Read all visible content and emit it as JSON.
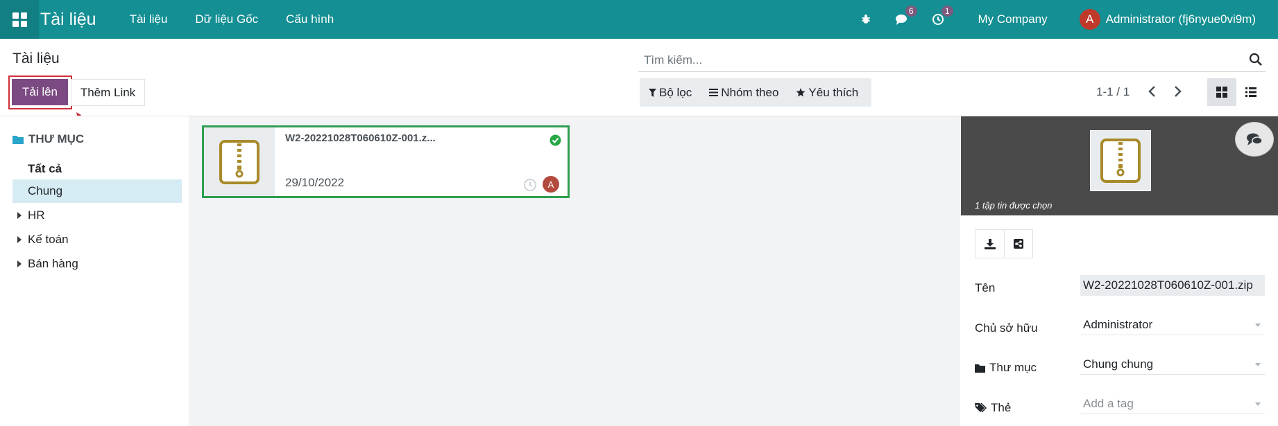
{
  "navbar": {
    "app_title": "Tài liệu",
    "menu": [
      "Tài liệu",
      "Dữ liệu Gốc",
      "Cấu hình"
    ],
    "messages_count": "6",
    "activities_count": "1",
    "company": "My Company",
    "user_initial": "A",
    "user_name": "Administrator (fj6nyue0vi9m)"
  },
  "control": {
    "page_title": "Tài liệu",
    "upload_label": "Tải lên",
    "add_link_label": "Thêm Link",
    "search_placeholder": "Tìm kiếm...",
    "filter_label": "Bộ lọc",
    "group_label": "Nhóm theo",
    "favorite_label": "Yêu thích",
    "pager": "1-1 / 1"
  },
  "sidebar": {
    "heading": "THƯ MỤC",
    "items": [
      {
        "label": "Tất cả"
      },
      {
        "label": "Chung"
      },
      {
        "label": "HR"
      },
      {
        "label": "Kế toán"
      },
      {
        "label": "Bán hàng"
      }
    ]
  },
  "card": {
    "name": "W2-20221028T060610Z-001.z...",
    "date": "29/10/2022",
    "owner_initial": "A"
  },
  "inspector": {
    "selected_text": "1 tập tin được chọn",
    "fields": {
      "name_label": "Tên",
      "name_value": "W2-20221028T060610Z-001.zip",
      "owner_label": "Chủ sở hữu",
      "owner_value": "Administrator",
      "folder_label": "Thư mục",
      "folder_value": "Chung chung",
      "tag_label": "Thẻ",
      "tag_placeholder": "Add a tag"
    }
  },
  "colors": {
    "navbar": "#148f93",
    "primary": "#7c4a83",
    "selected_card_border": "#2e9e50",
    "annotation": "#d0303a"
  }
}
